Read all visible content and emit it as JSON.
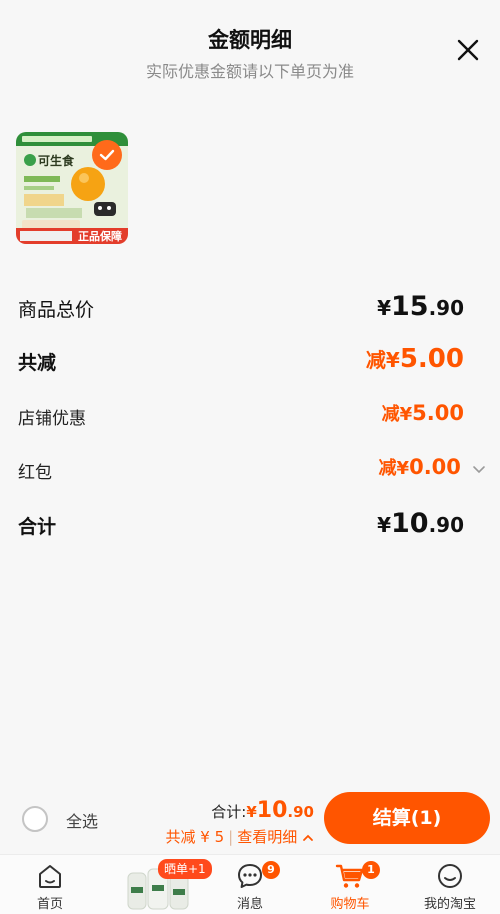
{
  "header": {
    "title": "金额明细",
    "subtitle": "实际优惠金额请以下单页为准",
    "close_icon": "close-icon"
  },
  "product": {
    "image_icon": "product-thumbnail",
    "brand_text": "可生食",
    "guarantee_text": "正品保障",
    "selected": true,
    "colors": {
      "check": "#ff6a1a"
    }
  },
  "rows": {
    "subtotal": {
      "label": "商品总价",
      "yen": "¥",
      "int": "15",
      "dec": ".90"
    },
    "total_discount": {
      "label": "共减",
      "prefix": "减¥",
      "amount": "5.00"
    },
    "shop_discount": {
      "label": "店铺优惠",
      "prefix": "减¥",
      "amount": "5.00"
    },
    "red_packet": {
      "label": "红包",
      "prefix": "减¥",
      "amount": "0.00"
    },
    "total": {
      "label": "合计",
      "yen": "¥",
      "int": "10",
      "dec": ".90"
    }
  },
  "bottom_bar": {
    "select_all_label": "全选",
    "total_prefix": "合计:",
    "total_yen": "¥",
    "total_int": "10",
    "total_dec": ".90",
    "discount_text": "共减 ¥ 5",
    "detail_link": "查看明细",
    "checkout_label": "结算(1)"
  },
  "tabbar": {
    "tabs": [
      {
        "label": "首页",
        "icon": "home-icon"
      },
      {
        "label": "",
        "icon": "promo-product-icon",
        "badge": "晒单+1"
      },
      {
        "label": "消息",
        "icon": "message-icon",
        "badge": "9"
      },
      {
        "label": "购物车",
        "icon": "cart-icon",
        "badge": "1",
        "active": true
      },
      {
        "label": "我的淘宝",
        "icon": "profile-icon"
      }
    ]
  },
  "colors": {
    "accent": "#ff5500",
    "text": "#111111",
    "muted": "#8a8a8a",
    "background": "#f7f7f7"
  }
}
